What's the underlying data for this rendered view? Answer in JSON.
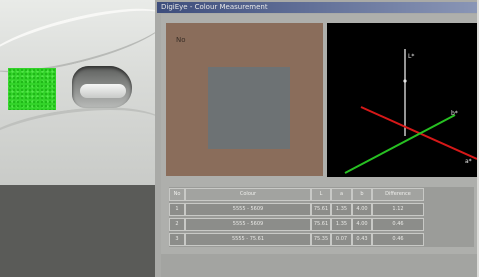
{
  "window": {
    "title": "DigiEye - Colour Measurement"
  },
  "sample": {
    "number": "No"
  },
  "axes": {
    "lightness": "L*",
    "b": "b*",
    "a": "a*"
  },
  "table": {
    "columns": [
      "No",
      "Colour",
      "L",
      "a",
      "b",
      "Difference"
    ],
    "rows": [
      {
        "no": "1",
        "colour": "5555 - 5609",
        "l": "75.61",
        "a": "1.35",
        "b": "4.00",
        "diff": "1.12"
      },
      {
        "no": "2",
        "colour": "5555 - 5609",
        "l": "75.61",
        "a": "1.35",
        "b": "4.00",
        "diff": "0.46"
      },
      {
        "no": "3",
        "colour": "5555 - 75.61",
        "l": "75.35",
        "a": "0.07",
        "b": "0.43",
        "diff": "0.46"
      }
    ]
  },
  "colors": {
    "sample_background": "#8a6d5b",
    "sample_center": "#6d7274",
    "green_patch": "#33d42a"
  }
}
